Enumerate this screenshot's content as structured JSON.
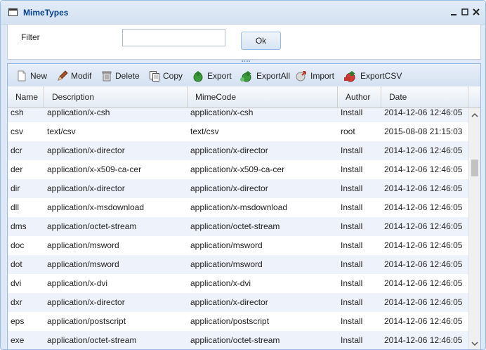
{
  "window": {
    "title": "MimeTypes"
  },
  "filter": {
    "label": "Filter",
    "value": "",
    "ok_label": "Ok"
  },
  "toolbar": {
    "new_label": "New",
    "modif_label": "Modif",
    "delete_label": "Delete",
    "copy_label": "Copy",
    "export_label": "Export",
    "exportall_label": "ExportAll",
    "import_label": "Import",
    "exportcsv_label": "ExportCSV"
  },
  "grid": {
    "columns": [
      "Name",
      "Description",
      "MimeCode",
      "Author",
      "Date"
    ],
    "rows": [
      {
        "name": "csh",
        "description": "application/x-csh",
        "mimecode": "application/x-csh",
        "author": "Install",
        "date": "2014-12-06 12:46:05"
      },
      {
        "name": "csv",
        "description": "text/csv",
        "mimecode": "text/csv",
        "author": "root",
        "date": "2015-08-08 21:15:03"
      },
      {
        "name": "dcr",
        "description": "application/x-director",
        "mimecode": "application/x-director",
        "author": "Install",
        "date": "2014-12-06 12:46:05"
      },
      {
        "name": "der",
        "description": "application/x-x509-ca-cer",
        "mimecode": "application/x-x509-ca-cer",
        "author": "Install",
        "date": "2014-12-06 12:46:05"
      },
      {
        "name": "dir",
        "description": "application/x-director",
        "mimecode": "application/x-director",
        "author": "Install",
        "date": "2014-12-06 12:46:05"
      },
      {
        "name": "dll",
        "description": "application/x-msdownload",
        "mimecode": "application/x-msdownload",
        "author": "Install",
        "date": "2014-12-06 12:46:05"
      },
      {
        "name": "dms",
        "description": "application/octet-stream",
        "mimecode": "application/octet-stream",
        "author": "Install",
        "date": "2014-12-06 12:46:05"
      },
      {
        "name": "doc",
        "description": "application/msword",
        "mimecode": "application/msword",
        "author": "Install",
        "date": "2014-12-06 12:46:05"
      },
      {
        "name": "dot",
        "description": "application/msword",
        "mimecode": "application/msword",
        "author": "Install",
        "date": "2014-12-06 12:46:05"
      },
      {
        "name": "dvi",
        "description": "application/x-dvi",
        "mimecode": "application/x-dvi",
        "author": "Install",
        "date": "2014-12-06 12:46:05"
      },
      {
        "name": "dxr",
        "description": "application/x-director",
        "mimecode": "application/x-director",
        "author": "Install",
        "date": "2014-12-06 12:46:05"
      },
      {
        "name": "eps",
        "description": "application/postscript",
        "mimecode": "application/postscript",
        "author": "Install",
        "date": "2014-12-06 12:46:05"
      },
      {
        "name": "exe",
        "description": "application/octet-stream",
        "mimecode": "application/octet-stream",
        "author": "Install",
        "date": "2014-12-06 12:46:05"
      }
    ]
  }
}
